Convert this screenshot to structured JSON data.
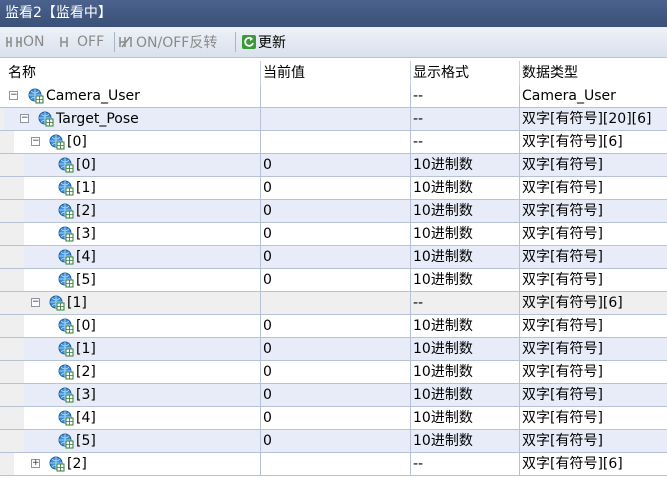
{
  "window": {
    "title": "监看2【监看中】"
  },
  "toolbar": {
    "on_label": "ON",
    "off_label": "OFF",
    "toggle_label": "ON/OFF反转",
    "refresh_label": "更新"
  },
  "columns": {
    "name": "名称",
    "current": "当前值",
    "format": "显示格式",
    "type": "数据类型"
  },
  "rows": [
    {
      "name": "Camera_User",
      "level": 0,
      "expander": "-",
      "current": "",
      "format": "--",
      "type": "Camera_User"
    },
    {
      "name": "Target_Pose",
      "level": 1,
      "expander": "-",
      "current": "",
      "format": "--",
      "type": "双字[有符号][20][6]"
    },
    {
      "name": "[0]",
      "level": 2,
      "expander": "-",
      "current": "",
      "format": "--",
      "type": "双字[有符号][6]"
    },
    {
      "name": "[0]",
      "level": 3,
      "expander": "",
      "current": "0",
      "format": "10进制数",
      "type": "双字[有符号]"
    },
    {
      "name": "[1]",
      "level": 3,
      "expander": "",
      "current": "0",
      "format": "10进制数",
      "type": "双字[有符号]"
    },
    {
      "name": "[2]",
      "level": 3,
      "expander": "",
      "current": "0",
      "format": "10进制数",
      "type": "双字[有符号]"
    },
    {
      "name": "[3]",
      "level": 3,
      "expander": "",
      "current": "0",
      "format": "10进制数",
      "type": "双字[有符号]"
    },
    {
      "name": "[4]",
      "level": 3,
      "expander": "",
      "current": "0",
      "format": "10进制数",
      "type": "双字[有符号]"
    },
    {
      "name": "[5]",
      "level": 3,
      "expander": "",
      "current": "0",
      "format": "10进制数",
      "type": "双字[有符号]"
    },
    {
      "name": "[1]",
      "level": 2,
      "expander": "-",
      "current": "",
      "format": "--",
      "type": "双字[有符号][6]"
    },
    {
      "name": "[0]",
      "level": 3,
      "expander": "",
      "current": "0",
      "format": "10进制数",
      "type": "双字[有符号]"
    },
    {
      "name": "[1]",
      "level": 3,
      "expander": "",
      "current": "0",
      "format": "10进制数",
      "type": "双字[有符号]"
    },
    {
      "name": "[2]",
      "level": 3,
      "expander": "",
      "current": "0",
      "format": "10进制数",
      "type": "双字[有符号]"
    },
    {
      "name": "[3]",
      "level": 3,
      "expander": "",
      "current": "0",
      "format": "10进制数",
      "type": "双字[有符号]"
    },
    {
      "name": "[4]",
      "level": 3,
      "expander": "",
      "current": "0",
      "format": "10进制数",
      "type": "双字[有符号]"
    },
    {
      "name": "[5]",
      "level": 3,
      "expander": "",
      "current": "0",
      "format": "10进制数",
      "type": "双字[有符号]"
    },
    {
      "name": "[2]",
      "level": 2,
      "expander": "+",
      "current": "",
      "format": "--",
      "type": "双字[有符号][6]"
    }
  ],
  "colors": {
    "titlebar": "#3f5580",
    "row_alt": "#e8ecf8",
    "grid_line": "#b7c3d5"
  },
  "icons": {
    "variable": "globe-grid-icon",
    "refresh": "refresh-icon",
    "contact": "contact-symbol-icon"
  }
}
